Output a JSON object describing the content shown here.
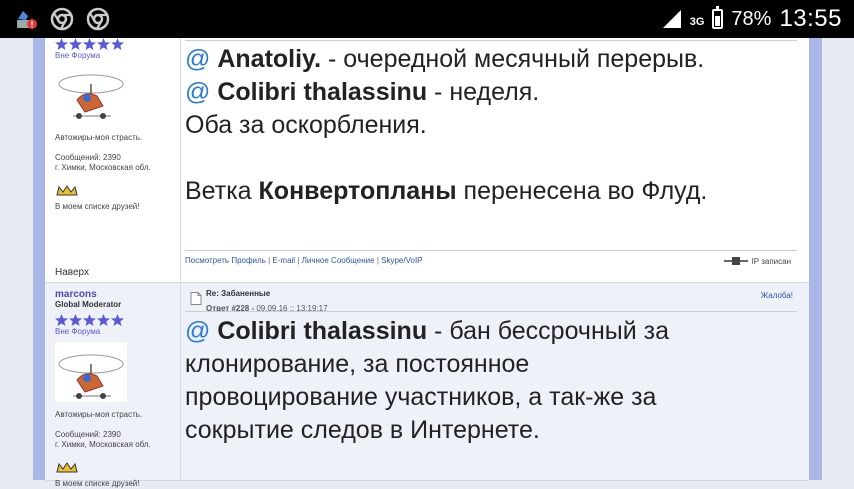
{
  "statusbar": {
    "network": "3G",
    "battery": "78%",
    "battery_level": 0.78,
    "time": "13:55"
  },
  "post1": {
    "profile": {
      "status": "Вне Форума",
      "motto": "Автожиры-моя страсть.",
      "messages": "Сообщений: 2390",
      "location": "г. Химки, Московская обл.",
      "friends": "В моем списке друзей!",
      "back_to_top": "Наверх"
    },
    "lines": {
      "at1": "@",
      "nick1": "Anatoliy.",
      "text1": " - очередной месячный перерыв.",
      "at2": "@",
      "nick2": "Colibri thalassinu",
      "text2": " - неделя.",
      "text3": "Оба за оскорбления.",
      "text4a": "Ветка ",
      "text4b": "Конвертопланы",
      "text4c": " перенесена во Флуд."
    },
    "footer": {
      "profile": "Посмотреть Профиль",
      "email": "E-mail",
      "pm": "Личное Сообщение",
      "skype": "Skype/VoIP",
      "ip": "IP записан"
    }
  },
  "post2": {
    "profile": {
      "username": "marcons",
      "role": "Global Moderator",
      "status": "Вне Форума",
      "motto": "Автожиры-моя страсть.",
      "messages": "Сообщений: 2390",
      "location": "г. Химки, Московская обл.",
      "friends": "В моем списке друзей!"
    },
    "header": {
      "subject": "Re: Забаненные",
      "reply_label": "Ответ #228 -",
      "date": " 09.09.16 :: 13:19:17",
      "complain": "Жалоба!"
    },
    "lines": {
      "at": "@",
      "nick": "Colibri thalassinu",
      "text1": " - бан бессрочный за",
      "text2": "клонирование, за постоянное",
      "text3": "провоцирование участников, а так-же за",
      "text4": "сокрытие следов в Интернете."
    }
  },
  "colors": {
    "link": "#2a7ad5",
    "star": "#5a5ad8",
    "rail": "#a8b7e6"
  }
}
